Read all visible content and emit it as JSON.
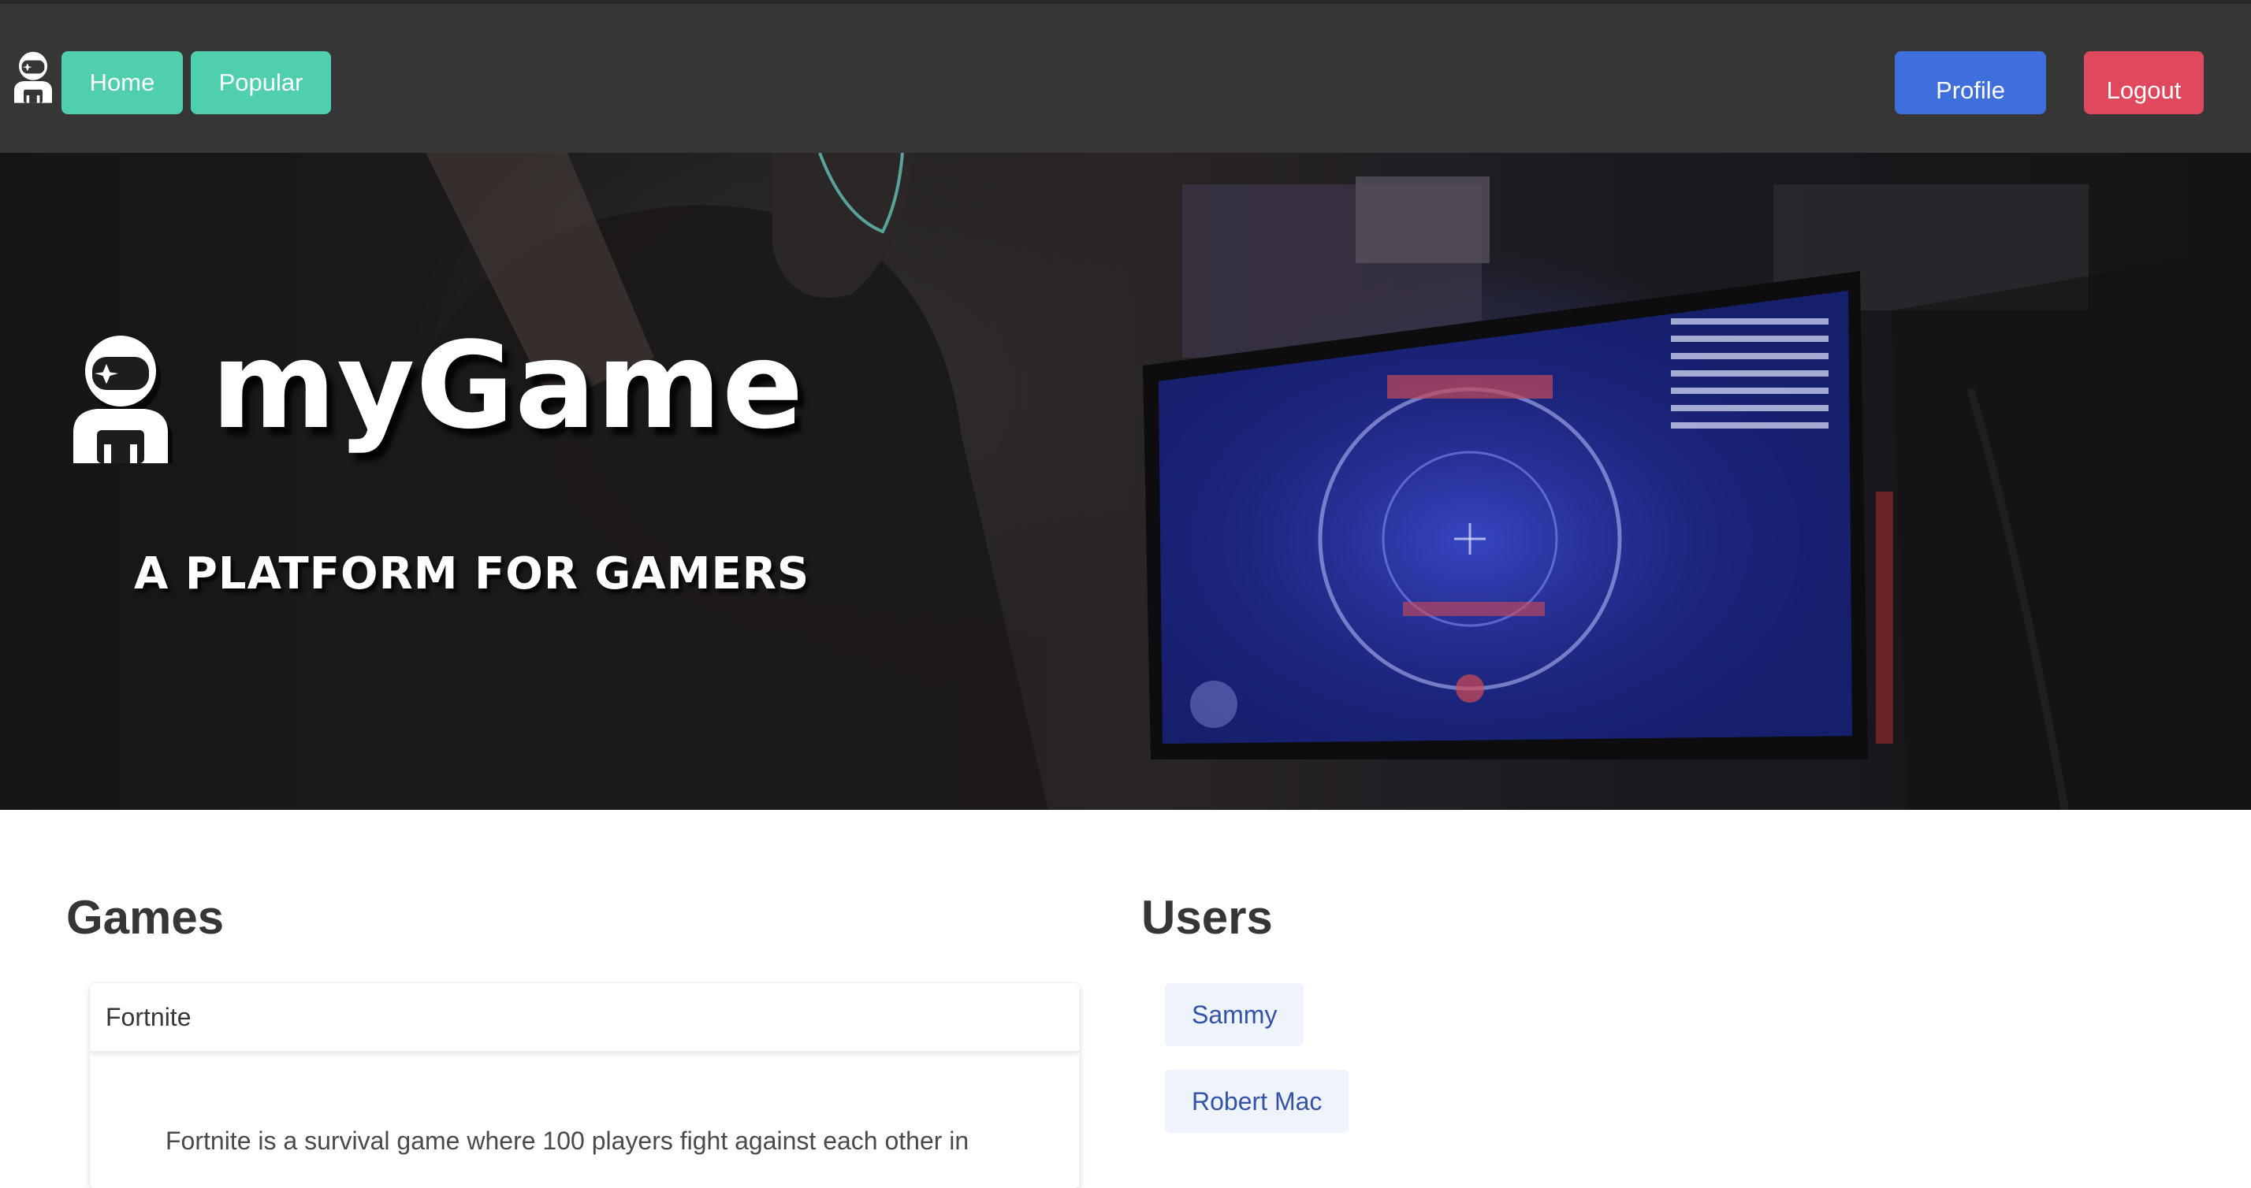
{
  "navbar": {
    "logo_icon": "astronaut-icon",
    "home_label": "Home",
    "popular_label": "Popular",
    "profile_label": "Profile",
    "logout_label": "Logout",
    "colors": {
      "background": "#363636",
      "primary_button": "#4fcfae",
      "profile_button": "#3e6fdc",
      "logout_button": "#e0485e"
    }
  },
  "hero": {
    "logo_icon": "astronaut-icon",
    "title": "myGame",
    "subtitle": "A PLATFORM FOR GAMERS"
  },
  "games": {
    "title": "Games",
    "items": [
      {
        "name": "Fortnite",
        "description": "Fortnite is a survival game where 100 players fight against each other in"
      }
    ]
  },
  "users": {
    "title": "Users",
    "items": [
      {
        "name": "Sammy"
      },
      {
        "name": "Robert Mac"
      }
    ],
    "tag_color": "#eef3fc",
    "tag_text_color": "#3253a8"
  }
}
